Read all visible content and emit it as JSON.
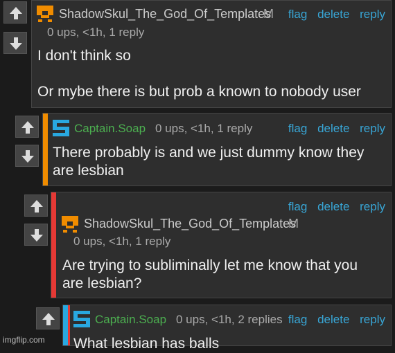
{
  "comments": [
    {
      "username": "ShadowSkul_The_God_Of_Templates",
      "badge": "M",
      "meta": "0 ups, <1h, 1 reply",
      "body_lines": [
        "I don't think so",
        "",
        "Or mybe there is but prob a known to nobody user"
      ],
      "actions": [
        "flag",
        "delete",
        "reply"
      ]
    },
    {
      "username": "Captain.Soap",
      "badge": "",
      "meta": "0 ups, <1h, 1 reply",
      "body_lines": [
        "There probably is and we just dummy know they",
        "are lesbian"
      ],
      "actions": [
        "flag",
        "delete",
        "reply"
      ]
    },
    {
      "username": "ShadowSkul_The_God_Of_Templates",
      "badge": "M",
      "meta": "0 ups, <1h, 1 reply",
      "body_lines": [
        "Are trying to subliminally let me know that you",
        "are lesbian?"
      ],
      "actions": [
        "flag",
        "delete",
        "reply"
      ]
    },
    {
      "username": "Captain.Soap",
      "badge": "",
      "meta": "0 ups, <1h, 2 replies",
      "body_lines": [
        "What lesbian has balls"
      ],
      "actions": [
        "flag",
        "delete",
        "reply"
      ]
    }
  ],
  "colors": {
    "shadow_name": "#cccccc",
    "soap_name": "#4caf50",
    "orange_bar": "#f08c00",
    "red_bar": "#e53935",
    "blue_bar": "#29a8e0",
    "link": "#38a6d6"
  },
  "icons": {
    "upvote": "arrow-up-icon",
    "downvote": "arrow-down-icon"
  },
  "watermark": "imgflip.com"
}
